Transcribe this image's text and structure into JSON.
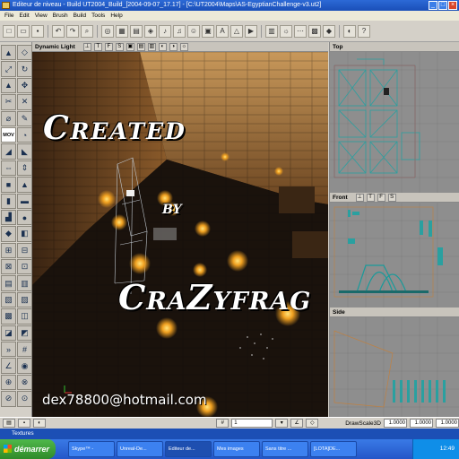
{
  "window": {
    "title": "Editeur de niveau - Build UT2004_Build_[2004-09-07_17.17] - [C:\\UT2004\\Maps\\AS-EgyptianChallenge-v3.ut2]"
  },
  "menu": [
    "File",
    "Edit",
    "View",
    "Brush",
    "Build",
    "Tools",
    "Help"
  ],
  "viewports": {
    "perspective": {
      "label": "Dynamic Light",
      "buttons": [
        "T",
        "F",
        "S"
      ]
    },
    "top": {
      "label": "Top",
      "buttons": [
        "T",
        "F",
        "S"
      ]
    },
    "front": {
      "label": "Front",
      "buttons": [
        "T",
        "F",
        "S"
      ]
    },
    "side": {
      "label": "Side",
      "buttons": [
        "T",
        "F",
        "S"
      ]
    }
  },
  "overlay": {
    "line1": "Created",
    "line2": "by",
    "line3": "CraZyfrag",
    "email": "dex78800@hotmail.com"
  },
  "toolbox": {
    "mov_label": "MOV"
  },
  "status": {
    "grid_value": "1",
    "drawscale_label": "DrawScale3D",
    "drawscale": [
      "1.0000",
      "1.0000",
      "1.0000"
    ]
  },
  "textures_bar": {
    "label": "Textures"
  },
  "taskbar": {
    "start": "démarrer",
    "tasks": [
      "Skype™ -",
      "Unreal-De...",
      "Editeur de...",
      "Mes images",
      "Sans titre ...",
      "[LOTA]DE..."
    ],
    "clock": "12:49"
  },
  "colors": {
    "accent": "#2c69d6",
    "taskbar": "#2456c8",
    "start": "#3a9a34",
    "wire": "#1a9a9a"
  }
}
